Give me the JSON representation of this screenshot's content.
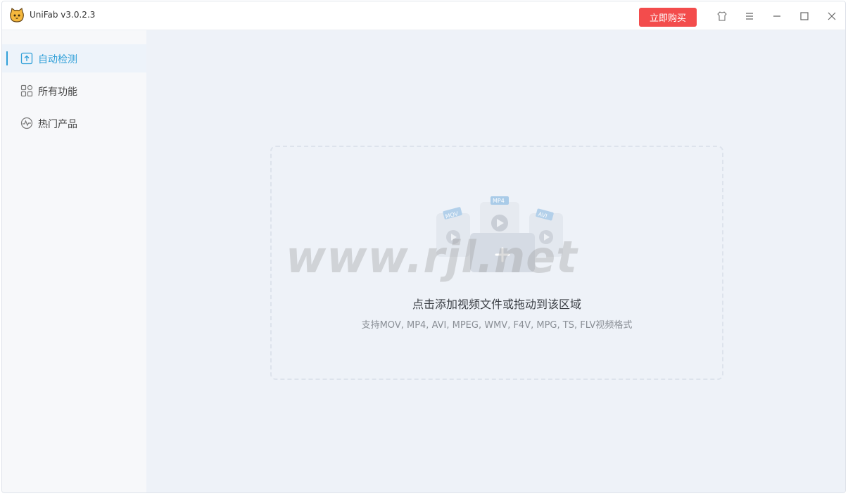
{
  "app": {
    "title": "UniFab v3.0.2.3",
    "logo_icon": "cat-face-icon"
  },
  "titlebar": {
    "buy_label": "立即购买",
    "buy_color": "#f34c4c",
    "icons": [
      "skin-icon",
      "menu-icon",
      "minimize-icon",
      "maximize-icon",
      "close-icon"
    ]
  },
  "sidebar": {
    "accent": "#2f9fd8",
    "items": [
      {
        "label": "自动检测",
        "icon": "upload-box-icon",
        "active": true
      },
      {
        "label": "所有功能",
        "icon": "grid-icon",
        "active": false
      },
      {
        "label": "热门产品",
        "icon": "pulse-circle-icon",
        "active": false
      }
    ]
  },
  "dropzone": {
    "title": "点击添加视频文件或拖动到该区域",
    "subtitle": "支持MOV, MP4, AVI, MPEG, WMV, F4V, MPG, TS, FLV视频格式",
    "badges": [
      "MOV",
      "MP4",
      "AVI"
    ],
    "watermark": "www.rjl.net"
  }
}
